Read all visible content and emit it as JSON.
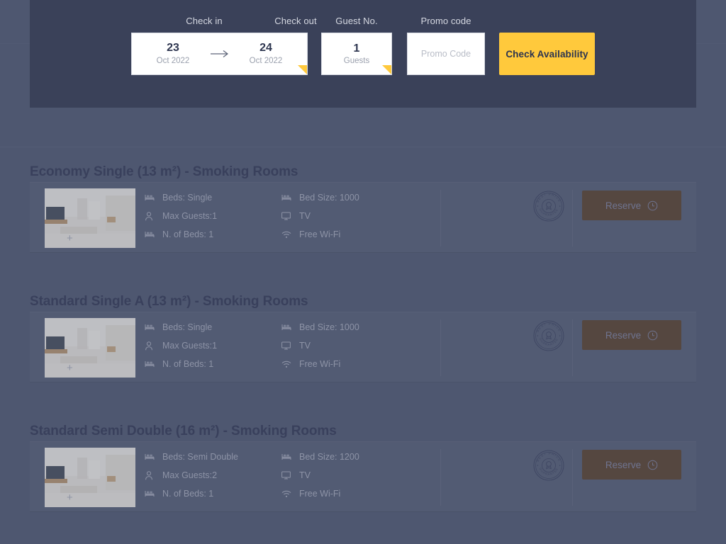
{
  "booking_bar": {
    "check_in": {
      "label": "Check in",
      "day": "23",
      "month_year": "Oct 2022"
    },
    "check_out": {
      "label": "Check out",
      "day": "24",
      "month_year": "Oct 2022"
    },
    "arrow_icon": "arrow-right-icon",
    "guests": {
      "label": "Guest No.",
      "count": "1",
      "unit": "Guests"
    },
    "promo": {
      "label": "Promo code",
      "value": "",
      "placeholder": "Promo Code"
    },
    "check_availability_label": "Check Availability",
    "accent_color": "#ffc93c",
    "panel_color": "#3a4159"
  },
  "rooms": [
    {
      "title": "Economy Single (13 m²) - Smoking Rooms",
      "thumb_plus": "+",
      "specs_left": [
        {
          "icon": "bed-icon",
          "text": "Beds: Single"
        },
        {
          "icon": "person-icon",
          "text": "Max Guests:1"
        },
        {
          "icon": "bed-icon",
          "text": "N. of Beds: 1"
        }
      ],
      "specs_right": [
        {
          "icon": "bed-icon",
          "text": "Bed Size: 1000"
        },
        {
          "icon": "tv-icon",
          "text": "TV"
        },
        {
          "icon": "wifi-icon",
          "text": "Free Wi-Fi"
        }
      ],
      "badge": {
        "icon": "best-price-guarantee-badge",
        "top_text": "BEST PRICE",
        "bottom_text": "GUARANTEE"
      },
      "reserve": {
        "label": "Reserve",
        "icon": "clock-icon"
      }
    },
    {
      "title": "Standard Single A (13 m²) - Smoking Rooms",
      "thumb_plus": "+",
      "specs_left": [
        {
          "icon": "bed-icon",
          "text": "Beds: Single"
        },
        {
          "icon": "person-icon",
          "text": "Max Guests:1"
        },
        {
          "icon": "bed-icon",
          "text": "N. of Beds: 1"
        }
      ],
      "specs_right": [
        {
          "icon": "bed-icon",
          "text": "Bed Size: 1000"
        },
        {
          "icon": "tv-icon",
          "text": "TV"
        },
        {
          "icon": "wifi-icon",
          "text": "Free Wi-Fi"
        }
      ],
      "badge": {
        "icon": "best-price-guarantee-badge",
        "top_text": "BEST PRICE",
        "bottom_text": "GUARANTEE"
      },
      "reserve": {
        "label": "Reserve",
        "icon": "clock-icon"
      }
    },
    {
      "title": "Standard Semi Double (16 m²) - Smoking Rooms",
      "thumb_plus": "+",
      "specs_left": [
        {
          "icon": "bed-icon",
          "text": "Beds: Semi Double"
        },
        {
          "icon": "person-icon",
          "text": "Max Guests:2"
        },
        {
          "icon": "bed-icon",
          "text": "N. of Beds: 1"
        }
      ],
      "specs_right": [
        {
          "icon": "bed-icon",
          "text": "Bed Size: 1200"
        },
        {
          "icon": "tv-icon",
          "text": "TV"
        },
        {
          "icon": "wifi-icon",
          "text": "Free Wi-Fi"
        }
      ],
      "badge": {
        "icon": "best-price-guarantee-badge",
        "top_text": "BEST PRICE",
        "bottom_text": "GUARANTEE"
      },
      "reserve": {
        "label": "Reserve",
        "icon": "clock-icon"
      }
    }
  ]
}
